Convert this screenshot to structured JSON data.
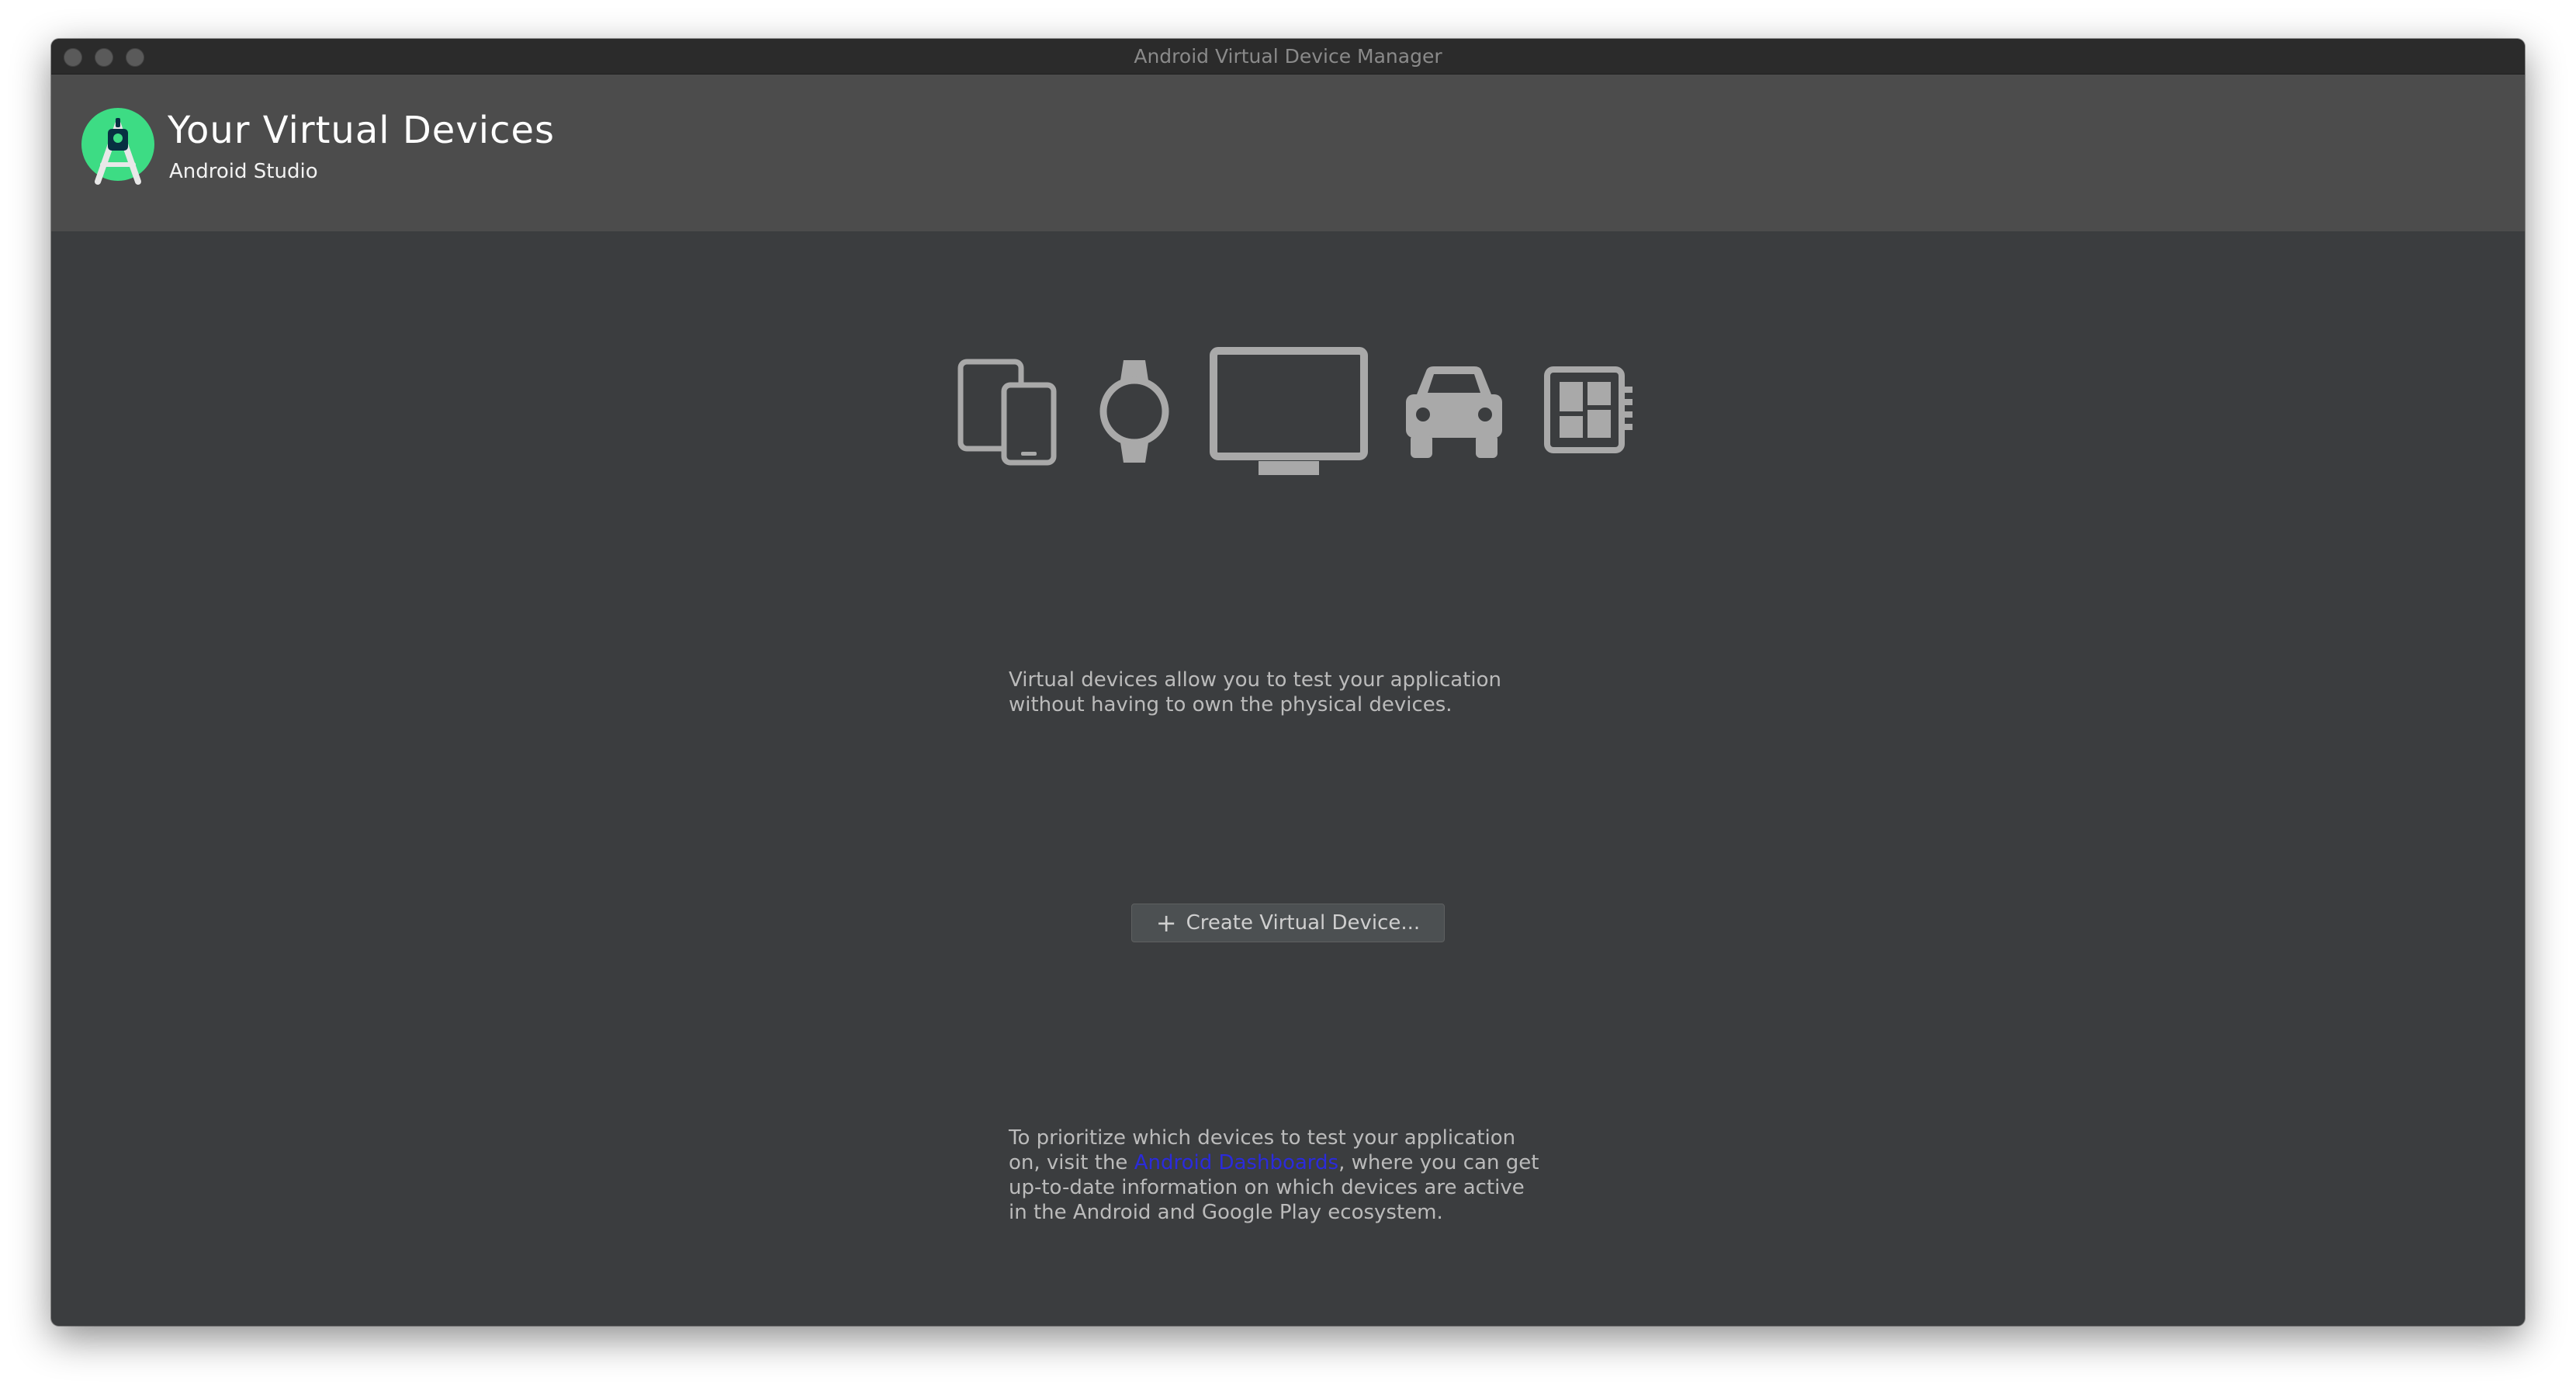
{
  "window": {
    "title": "Android Virtual Device Manager"
  },
  "header": {
    "title": "Your Virtual Devices",
    "subtitle": "Android Studio",
    "logo_icon": "android-studio-logo-icon"
  },
  "device_icons": [
    "phone-tablet-icon",
    "watch-icon",
    "tv-icon",
    "car-icon",
    "android-things-icon"
  ],
  "intro": {
    "line1": "Virtual devices allow you to test your application",
    "line2": "without having to own the physical devices."
  },
  "create_button": {
    "icon": "+",
    "label": "Create Virtual Device..."
  },
  "footer": {
    "line1": "To prioritize which devices to test your application",
    "line2_pre": "on, visit the ",
    "link_text": "Android Dashboards",
    "line2_post": ", where you can get",
    "line3": "up-to-date information on which devices are active",
    "line4": "in the Android and Google Play ecosystem."
  },
  "colors": {
    "background": "#3b3d3f",
    "header": "#4c4c4c",
    "titlebar": "#2b2b2b",
    "icon": "#a9a9a9",
    "link": "#2b2bdb",
    "logo_green": "#3ddc84"
  }
}
